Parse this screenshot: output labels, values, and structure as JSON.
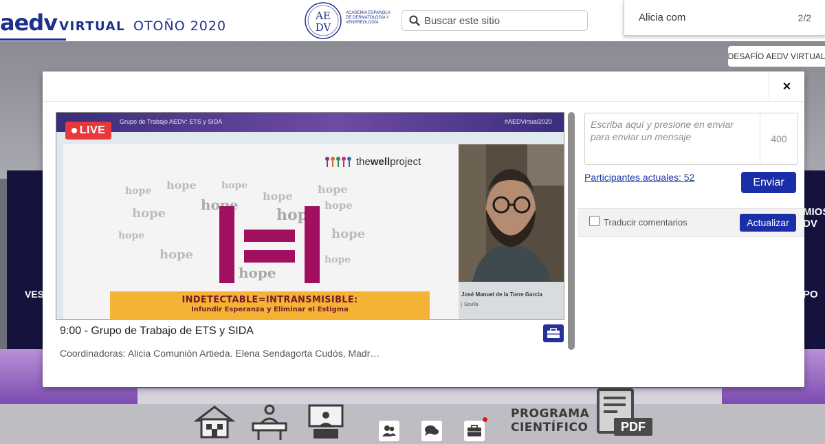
{
  "header": {
    "brand_main": "aedv",
    "brand_virtual": "VIRTUAL",
    "brand_season": "OTOÑO 2020",
    "logo_letters": "AEDV",
    "logo_text": "ACADEMIA ESPAÑOLA DE DERMATOLOGÍA Y VENEREOLOGÍA",
    "search": {
      "placeholder": "Buscar este sitio"
    }
  },
  "find_bar": {
    "query": "Alicia com",
    "count": "2/2"
  },
  "desafio_label": "DESAFÍO AEDV VIRTUAL",
  "background": {
    "left_text": "VES",
    "right_text_1": "MIOS DV",
    "right_text_2": "PO"
  },
  "modal": {
    "close_label": "×",
    "video": {
      "live_label": "LIVE",
      "session_band_text": "Grupo de Trabajo AEDV: ETS y SIDA",
      "hashtag": "#AEDVirtual2020",
      "slide": {
        "logo_text_thin": "the",
        "logo_text_bold": "well",
        "logo_text_tail": "project",
        "cloud_word": "hope",
        "bar_title": "INDETECTABLE=INTRANSMISIBLE:",
        "bar_subtitle": "Infundir Esperanza y Eliminar el Estigma"
      },
      "speaker_name": "José Manuel de la Torre García",
      "speaker_city": "Sevilla"
    },
    "session_title": "9:00 - Grupo de Trabajo de ETS y SIDA",
    "session_coordinators": "Coordinadoras: Alicia Comunión Artieda. Elena Sendagorta Cudós, Madr…",
    "chat": {
      "placeholder": "Escriba aquí y presione en enviar para enviar un mensaje",
      "char_count": "400",
      "participants_label": "Participantes actuales: 52",
      "send_label": "Enviar",
      "translate_label": "Traducir comentarios",
      "translate_checked": false,
      "update_label": "Actualizar"
    }
  },
  "bottom_nav": {
    "programa_line1": "PROGRAMA",
    "programa_line2": "CIENTÍFICO",
    "pdf_label": "PDF",
    "icons": [
      "home-icon",
      "reception-desk-icon",
      "presentation-icon",
      "users-icon",
      "chat-icon",
      "briefcase-icon"
    ]
  },
  "colors": {
    "brand_blue": "#1e2f8c",
    "button_blue": "#1a2ea7",
    "live_red": "#e8383b",
    "slide_magenta": "#a0105f",
    "slide_yellow": "#f4b334"
  }
}
